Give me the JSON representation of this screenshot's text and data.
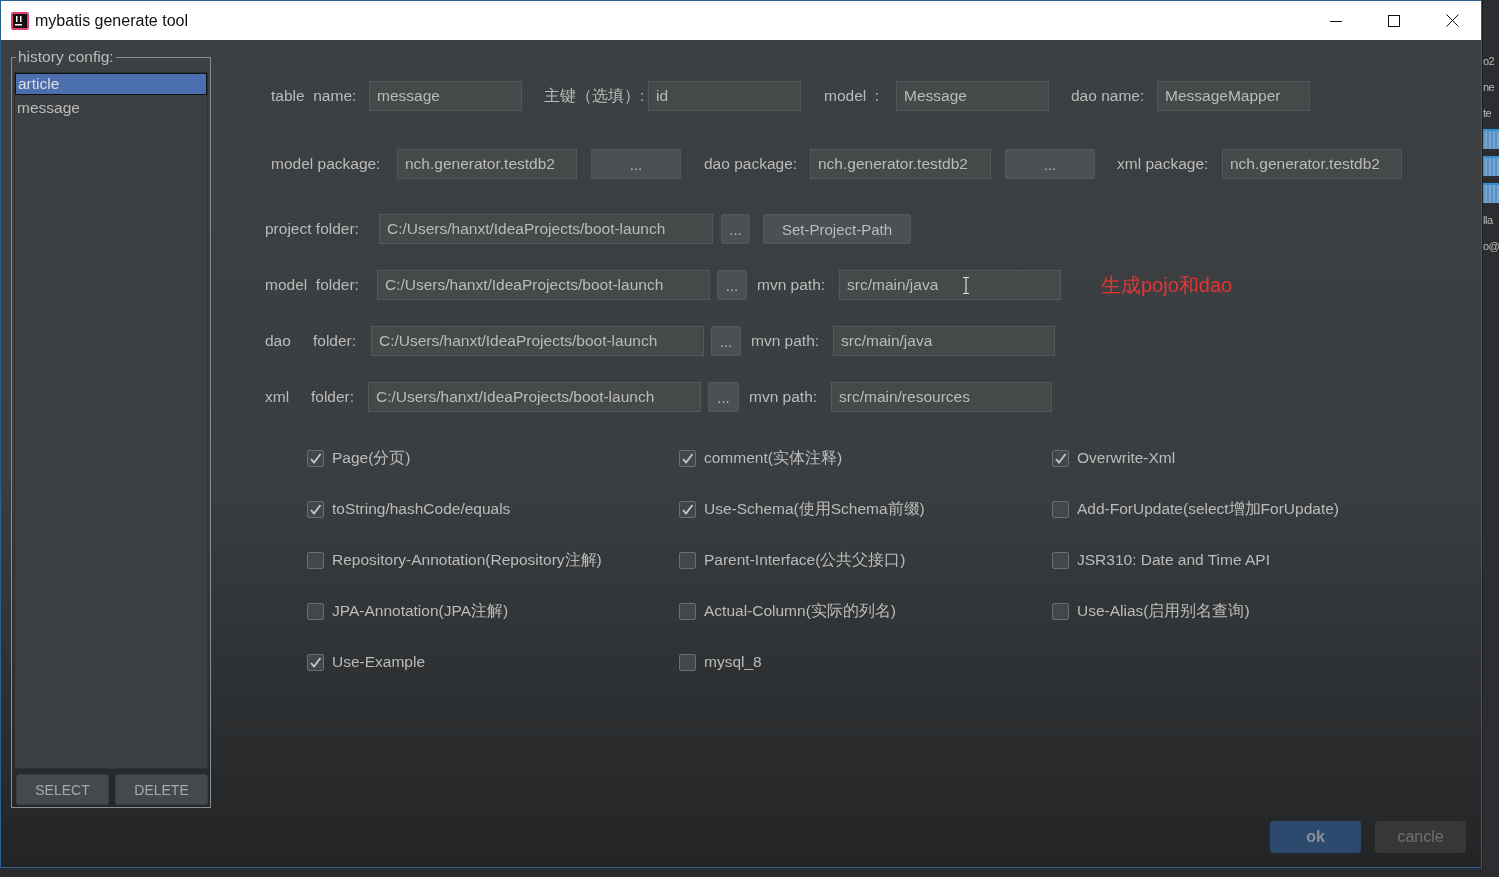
{
  "window": {
    "title": "mybatis generate tool"
  },
  "history": {
    "title": "history config:",
    "items": [
      {
        "label": "article",
        "selected": true
      },
      {
        "label": "message",
        "selected": false
      }
    ],
    "buttons": [
      "SELECT",
      "DELETE"
    ]
  },
  "form_rows": [
    {
      "items": [
        {
          "kind": "label",
          "text": "table  name:"
        },
        {
          "kind": "field",
          "value": "message"
        },
        {
          "kind": "label",
          "text": "主键（选填）:"
        },
        {
          "kind": "field",
          "value": "id"
        },
        {
          "kind": "label",
          "text": "model  :"
        },
        {
          "kind": "field",
          "value": "Message"
        },
        {
          "kind": "label",
          "text": "dao name:"
        },
        {
          "kind": "field",
          "value": "MessageMapper"
        }
      ]
    },
    {
      "items": [
        {
          "kind": "label",
          "text": "model package:"
        },
        {
          "kind": "field",
          "value": "nch.generator.testdb2"
        },
        {
          "kind": "button",
          "text": "..."
        },
        {
          "kind": "label",
          "text": "dao package:"
        },
        {
          "kind": "field",
          "value": "nch.generator.testdb2"
        },
        {
          "kind": "button",
          "text": "..."
        },
        {
          "kind": "label",
          "text": "xml package:"
        },
        {
          "kind": "field",
          "value": "nch.generator.testdb2"
        }
      ]
    },
    {
      "items": [
        {
          "kind": "label",
          "text": "project folder:"
        },
        {
          "kind": "field",
          "value": "C:/Users/hanxt/IdeaProjects/boot-launch"
        },
        {
          "kind": "button",
          "text": "..."
        },
        {
          "kind": "button",
          "text": "Set-Project-Path"
        }
      ]
    },
    {
      "items": [
        {
          "kind": "label",
          "text": "model  folder:"
        },
        {
          "kind": "field",
          "value": "C:/Users/hanxt/IdeaProjects/boot-launch"
        },
        {
          "kind": "button",
          "text": "..."
        },
        {
          "kind": "label",
          "text": "mvn path:"
        },
        {
          "kind": "field",
          "value": "src/main/java",
          "cursor": true
        },
        {
          "kind": "note",
          "text": "生成pojo和dao"
        }
      ]
    },
    {
      "items": [
        {
          "kind": "label",
          "text": "dao"
        },
        {
          "kind": "label",
          "text": "folder:"
        },
        {
          "kind": "field",
          "value": "C:/Users/hanxt/IdeaProjects/boot-launch"
        },
        {
          "kind": "button",
          "text": "..."
        },
        {
          "kind": "label",
          "text": "mvn path:"
        },
        {
          "kind": "field",
          "value": "src/main/java"
        }
      ]
    },
    {
      "items": [
        {
          "kind": "label",
          "text": "xml"
        },
        {
          "kind": "label",
          "text": "folder:"
        },
        {
          "kind": "field",
          "value": "C:/Users/hanxt/IdeaProjects/boot-launch"
        },
        {
          "kind": "button",
          "text": "..."
        },
        {
          "kind": "label",
          "text": "mvn path:"
        },
        {
          "kind": "field",
          "value": "src/main/resources"
        }
      ]
    }
  ],
  "options": [
    {
      "label": "Page(分页)",
      "checked": true
    },
    {
      "label": "comment(实体注释)",
      "checked": true
    },
    {
      "label": "Overwrite-Xml",
      "checked": true
    },
    {
      "label": "toString/hashCode/equals",
      "checked": true
    },
    {
      "label": "Use-Schema(使用Schema前缀)",
      "checked": true
    },
    {
      "label": "Add-ForUpdate(select增加ForUpdate)",
      "checked": false
    },
    {
      "label": "Repository-Annotation(Repository注解)",
      "checked": false
    },
    {
      "label": "Parent-Interface(公共父接口)",
      "checked": false
    },
    {
      "label": "JSR310: Date and Time API",
      "checked": false
    },
    {
      "label": "JPA-Annotation(JPA注解)",
      "checked": false
    },
    {
      "label": "Actual-Column(实际的列名)",
      "checked": false
    },
    {
      "label": "Use-Alias(启用别名查询)",
      "checked": false
    },
    {
      "label": "Use-Example",
      "checked": true
    },
    {
      "label": "mysql_8",
      "checked": false
    }
  ],
  "footer_buttons": [
    {
      "label": "ok",
      "kind": "primary"
    },
    {
      "label": "cancle",
      "kind": "secondary"
    }
  ],
  "background_edge": [
    "o2",
    "ne",
    "te",
    "lla",
    "o@"
  ]
}
